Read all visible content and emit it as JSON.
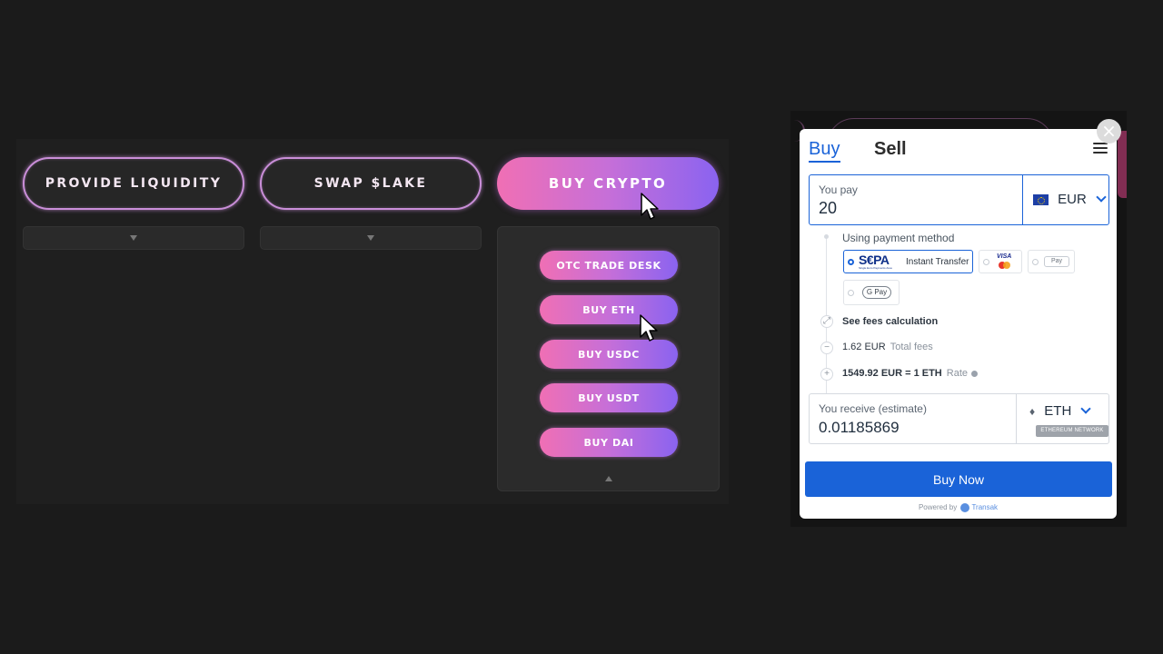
{
  "lake": {
    "buttons": {
      "provide_liquidity": "PROVIDE LIQUIDITY",
      "swap_lake": "SWAP $LAKE",
      "buy_crypto": "BUY CRYPTO"
    },
    "buy_menu": [
      "OTC TRADE DESK",
      "BUY ETH",
      "BUY USDC",
      "BUY USDT",
      "BUY DAI"
    ]
  },
  "widget": {
    "tabs": {
      "buy": "Buy",
      "sell": "Sell"
    },
    "you_pay": {
      "label": "You pay",
      "value": "20",
      "currency": "EUR"
    },
    "payment": {
      "label": "Using payment method",
      "sepa_logo": "S€PA",
      "sepa_tagline": "Single Euro Payments Area",
      "instant_transfer": "Instant Transfer",
      "visa": "VISA",
      "apple_pay": "Pay",
      "google_pay": "G Pay"
    },
    "fees": {
      "see_calc": "See fees calculation",
      "total_value": "1.62 EUR",
      "total_label": "Total fees",
      "rate_value": "1549.92 EUR = 1 ETH",
      "rate_label": "Rate"
    },
    "you_receive": {
      "label": "You receive (estimate)",
      "value": "0.01185869",
      "currency": "ETH",
      "network": "ETHEREUM NETWORK"
    },
    "buy_now": "Buy Now",
    "powered_by": "Powered by",
    "provider": "Transak"
  },
  "colors": {
    "brand_blue": "#1a63d8",
    "gradient_pink": "#f06fb4",
    "gradient_purple": "#8a63f0",
    "page_bg": "#1b1b1b"
  }
}
